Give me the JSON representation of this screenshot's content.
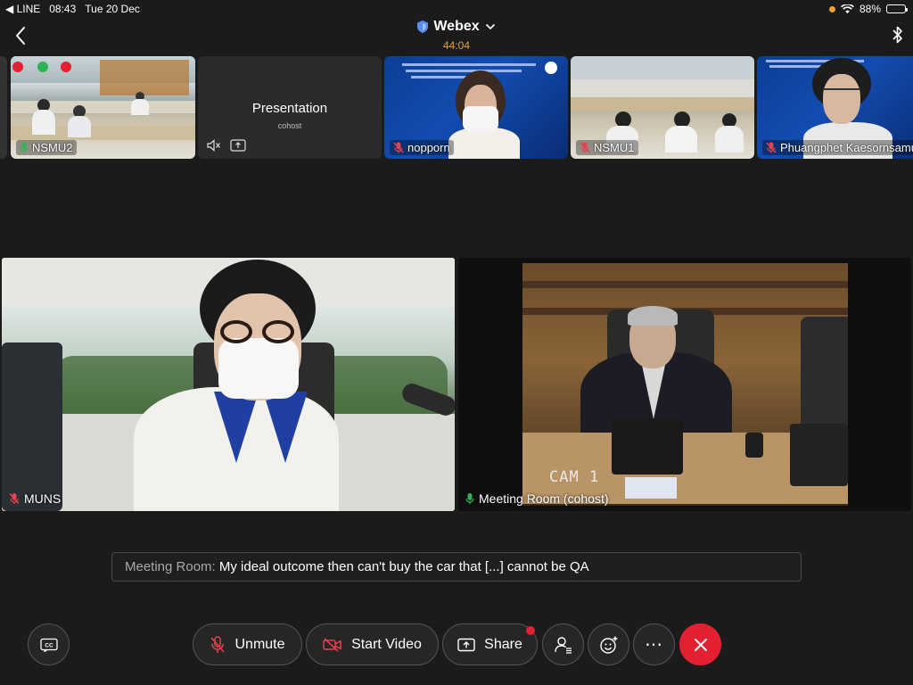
{
  "statusbar": {
    "back_app": "◀ LINE",
    "time": "08:43",
    "date": "Tue 20 Dec",
    "battery": "88%",
    "battery_level": 0.88
  },
  "header": {
    "title": "Webex",
    "timer": "44:04"
  },
  "thumbnails": [
    {
      "name": "NSMU2",
      "mic": "unmuted-green"
    },
    {
      "name": "Presentation",
      "subtitle": "cohost"
    },
    {
      "name": "nopporn",
      "mic": "muted"
    },
    {
      "name": "NSMU1",
      "mic": "muted"
    },
    {
      "name": "Phuangphet Kaesornsamut",
      "mic": "muted"
    }
  ],
  "main_tiles": [
    {
      "name": "MUNS",
      "mic": "muted"
    },
    {
      "name": "Meeting Room (cohost)",
      "mic": "unmuted-green",
      "cam_label": "CAM 1"
    }
  ],
  "caption": {
    "speaker": "Meeting Room:",
    "text": "My ideal outcome then can't buy the car that [...] cannot be QA"
  },
  "controls": {
    "cc_label": "CC",
    "unmute": "Unmute",
    "start_video": "Start Video",
    "share": "Share",
    "more": "⋯"
  },
  "colors": {
    "accent_red": "#e3202f",
    "timer": "#e6a23c",
    "muted_red": "#e0424f",
    "live_green": "#2fb455"
  }
}
